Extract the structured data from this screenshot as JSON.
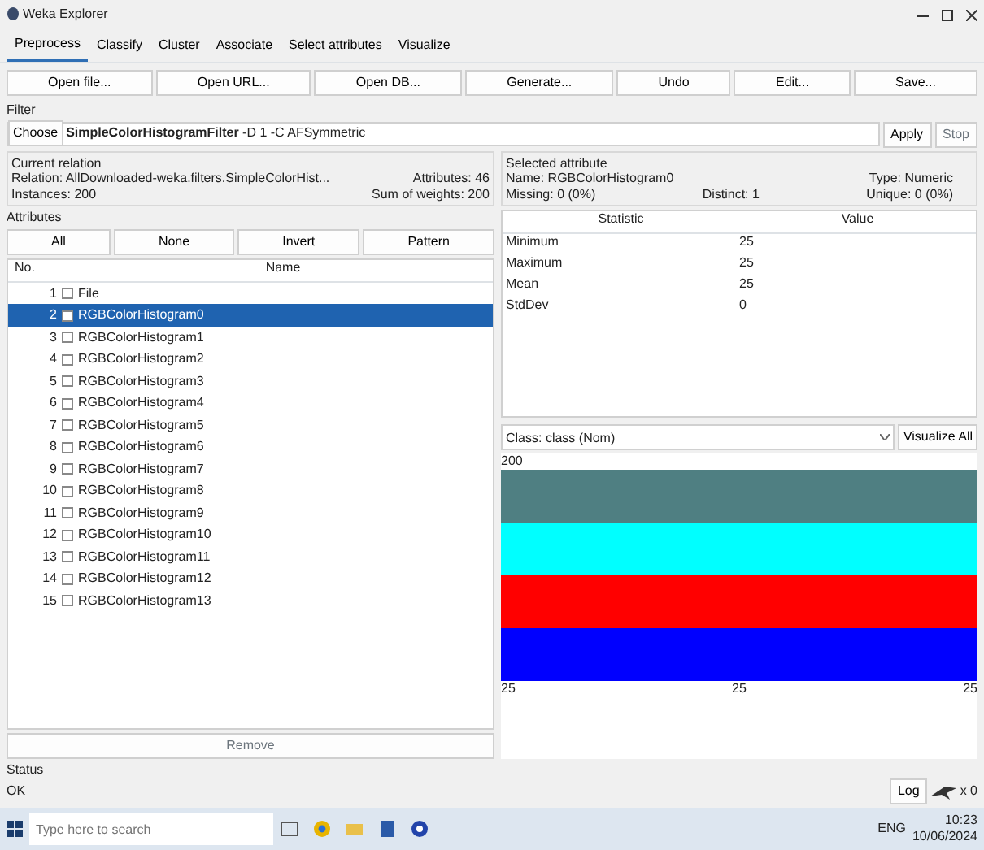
{
  "window": {
    "title": "Weka Explorer"
  },
  "tabs": [
    {
      "label": "Preprocess",
      "selected": true
    },
    {
      "label": "Classify",
      "selected": false
    },
    {
      "label": "Cluster",
      "selected": false
    },
    {
      "label": "Associate",
      "selected": false
    },
    {
      "label": "Select attributes",
      "selected": false
    },
    {
      "label": "Visualize",
      "selected": false
    }
  ],
  "toolbar": [
    "Open file...",
    "Open URL...",
    "Open DB...",
    "Generate...",
    "Undo",
    "Edit...",
    "Save..."
  ],
  "filter": {
    "heading": "Filter",
    "choose": "Choose",
    "name": "SimpleColorHistogramFilter",
    "options": "-D 1 -C AFSymmetric",
    "apply": "Apply",
    "stop": "Stop"
  },
  "relation": {
    "heading": "Current relation",
    "relation": "Relation: AllDownloaded-weka.filters.SimpleColorHist...",
    "attributes": "Attributes: 46",
    "instances": "Instances: 200",
    "weights": "Sum of weights: 200"
  },
  "selected": {
    "heading": "Selected attribute",
    "name": "Name: RGBColorHistogram0",
    "type": "Type: Numeric",
    "missing": "Missing: 0 (0%)",
    "distinct": "Distinct: 1",
    "unique": "Unique: 0 (0%)"
  },
  "attributes": {
    "heading": "Attributes",
    "buttons": [
      "All",
      "None",
      "Invert",
      "Pattern"
    ],
    "columns": [
      "No.",
      "Name"
    ],
    "rows": [
      {
        "no": "1",
        "name": "File",
        "checked": false,
        "selected": false
      },
      {
        "no": "2",
        "name": "RGBColorHistogram0",
        "checked": false,
        "selected": true
      },
      {
        "no": "3",
        "name": "RGBColorHistogram1",
        "checked": false,
        "selected": false
      },
      {
        "no": "4",
        "name": "RGBColorHistogram2",
        "checked": false,
        "selected": false
      },
      {
        "no": "5",
        "name": "RGBColorHistogram3",
        "checked": false,
        "selected": false
      },
      {
        "no": "6",
        "name": "RGBColorHistogram4",
        "checked": false,
        "selected": false
      },
      {
        "no": "7",
        "name": "RGBColorHistogram5",
        "checked": false,
        "selected": false
      },
      {
        "no": "8",
        "name": "RGBColorHistogram6",
        "checked": false,
        "selected": false
      },
      {
        "no": "9",
        "name": "RGBColorHistogram7",
        "checked": false,
        "selected": false
      },
      {
        "no": "10",
        "name": "RGBColorHistogram8",
        "checked": false,
        "selected": false
      },
      {
        "no": "11",
        "name": "RGBColorHistogram9",
        "checked": false,
        "selected": false
      },
      {
        "no": "12",
        "name": "RGBColorHistogram10",
        "checked": false,
        "selected": false
      },
      {
        "no": "13",
        "name": "RGBColorHistogram11",
        "checked": false,
        "selected": false
      },
      {
        "no": "14",
        "name": "RGBColorHistogram12",
        "checked": false,
        "selected": false
      },
      {
        "no": "15",
        "name": "RGBColorHistogram13",
        "checked": false,
        "selected": false
      }
    ],
    "remove": "Remove"
  },
  "statistics": {
    "columns": [
      "Statistic",
      "Value"
    ],
    "rows": [
      {
        "name": "Minimum",
        "value": "25"
      },
      {
        "name": "Maximum",
        "value": "25"
      },
      {
        "name": "Mean",
        "value": "25"
      },
      {
        "name": "StdDev",
        "value": "0"
      }
    ]
  },
  "class_select": {
    "value": "Class: class (Nom)",
    "visualize": "Visualize All"
  },
  "histogram": {
    "count_label": "200",
    "axis_labels": [
      "25",
      "25",
      "25"
    ],
    "segments": [
      {
        "color": "#4f7f82"
      },
      {
        "color": "#00ffff"
      },
      {
        "color": "#ff0000"
      },
      {
        "color": "#0000ff"
      }
    ]
  },
  "status": {
    "heading": "Status",
    "text": "OK",
    "log": "Log",
    "count": "x 0"
  },
  "taskbar": {
    "search_placeholder": "Type here to search",
    "tray": "ENG",
    "time": "10:23",
    "date": "10/06/2024"
  }
}
